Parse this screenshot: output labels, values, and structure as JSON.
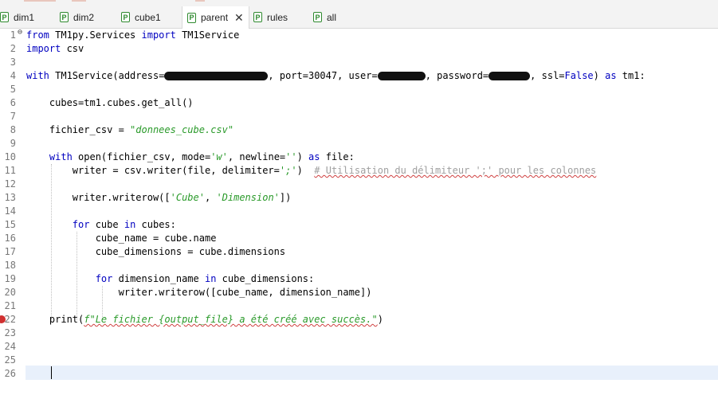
{
  "tabs": [
    {
      "label": "dim1",
      "icon": "python-file-icon",
      "active": false
    },
    {
      "label": "dim2",
      "icon": "python-file-icon",
      "active": false
    },
    {
      "label": "cube1",
      "icon": "python-file-icon",
      "active": false
    },
    {
      "label": "parent",
      "icon": "python-file-icon",
      "active": true
    },
    {
      "label": "rules",
      "icon": "python-file-icon",
      "active": false
    },
    {
      "label": "all",
      "icon": "python-file-icon",
      "active": false
    }
  ],
  "tab_icon_letter": "P",
  "tab_close_glyph": "✕",
  "fold_glyph": "⊖",
  "line_numbers": [
    "1",
    "2",
    "3",
    "4",
    "5",
    "6",
    "7",
    "8",
    "9",
    "10",
    "11",
    "12",
    "13",
    "14",
    "15",
    "16",
    "17",
    "18",
    "19",
    "20",
    "21",
    "22",
    "23",
    "24",
    "25",
    "26"
  ],
  "code": {
    "l1": {
      "kw1": "from",
      "mod": " TM1py.Services ",
      "kw2": "import",
      "rest": " TM1Service"
    },
    "l2": {
      "kw1": "import",
      "rest": " csv"
    },
    "l4": {
      "kw1": "with",
      "a": " TM1Service(address=",
      "b": ", port=30047, user=",
      "c": ", password=",
      "d": ", ssl=",
      "kw2": "False",
      "e": ") ",
      "kw3": "as",
      "f": " tm1:"
    },
    "l6": {
      "rest": "    cubes=tm1.cubes.get_all()"
    },
    "l8": {
      "a": "    fichier_csv = ",
      "str": "\"donnees_cube.csv\""
    },
    "l10": {
      "indent": "    ",
      "kw1": "with",
      "a": " open(fichier_csv, mode=",
      "str1": "'w'",
      "b": ", newline=",
      "str2": "''",
      "c": ") ",
      "kw2": "as",
      "d": " file:"
    },
    "l11": {
      "a": "        writer = csv.writer(file, delimiter=",
      "str": "';'",
      "b": ")  ",
      "cmt": "# Utilisation du délimiteur ';' pour les colonnes"
    },
    "l13": {
      "a": "        writer.writerow([",
      "str1": "'Cube'",
      "b": ", ",
      "str2": "'Dimension'",
      "c": "])"
    },
    "l15": {
      "indent": "        ",
      "kw1": "for",
      "a": " cube ",
      "kw2": "in",
      "b": " cubes:"
    },
    "l16": {
      "rest": "            cube_name = cube.name"
    },
    "l17": {
      "rest": "            cube_dimensions = cube.dimensions"
    },
    "l19": {
      "indent": "            ",
      "kw1": "for",
      "a": " dimension_name ",
      "kw2": "in",
      "b": " cube_dimensions:"
    },
    "l20": {
      "rest": "                writer.writerow([cube_name, dimension_name])"
    },
    "l22": {
      "a": "    print(",
      "str": "f\"Le fichier {output_file} a été créé avec succès.\"",
      "b": ")"
    }
  },
  "colors": {
    "keyword": "#0000c0",
    "string": "#2a9a2a",
    "comment": "#a0a0a0",
    "line_number": "#787878",
    "current_line": "#e8f0fb"
  }
}
